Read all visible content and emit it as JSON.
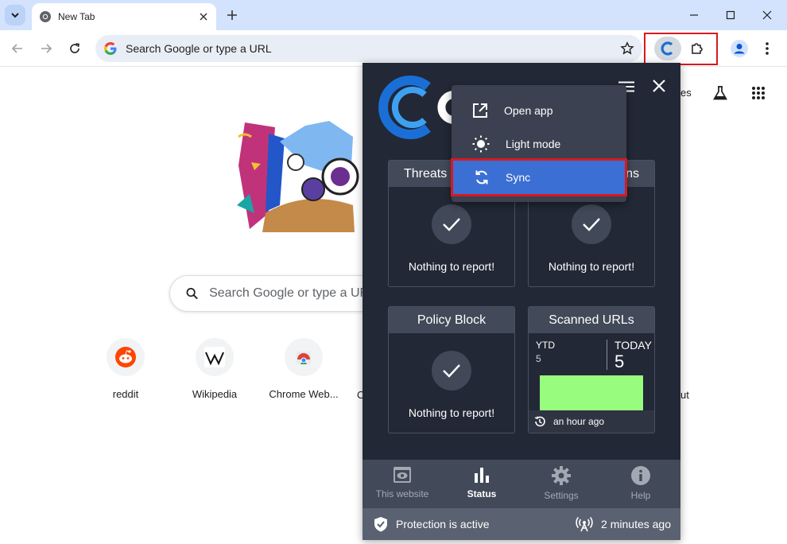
{
  "browser": {
    "tab_title": "New Tab",
    "omnibox_placeholder": "Search Google or type a URL"
  },
  "ntp": {
    "search_placeholder": "Search Google or type a URL",
    "shortcuts": [
      {
        "label": "reddit"
      },
      {
        "label": "Wikipedia"
      },
      {
        "label": "Chrome Web..."
      }
    ],
    "partial_labels": {
      "left_edge": "C",
      "right_edge": "ut",
      "top_right": "es"
    }
  },
  "popup": {
    "menu": {
      "items": [
        {
          "label": "Open app",
          "icon": "external-link-icon"
        },
        {
          "label": "Light mode",
          "icon": "sun-icon"
        },
        {
          "label": "Sync",
          "icon": "sync-icon",
          "selected": true
        }
      ]
    },
    "cards": {
      "threats": {
        "title_left": "Threats D",
        "title_right": "ns",
        "message": "Nothing to report!"
      },
      "detections": {
        "message": "Nothing to report!"
      },
      "policy": {
        "title": "Policy Block",
        "message": "Nothing to report!"
      },
      "scanned": {
        "title": "Scanned URLs",
        "ytd_label": "YTD",
        "ytd_value": "5",
        "today_label": "TODAY",
        "today_value": "5",
        "bar_fill_fraction": 1.0,
        "bar_color": "#98fc7f",
        "updated": "an hour ago"
      }
    },
    "nav": [
      {
        "label": "This website",
        "icon": "eye-icon"
      },
      {
        "label": "Status",
        "icon": "bar-chart-icon",
        "active": true
      },
      {
        "label": "Settings",
        "icon": "gear-icon"
      },
      {
        "label": "Help",
        "icon": "info-icon"
      }
    ],
    "status": {
      "protection": "Protection is active",
      "last_update": "2 minutes ago"
    },
    "colors": {
      "background": "#222836",
      "card_header": "#424958",
      "menu_selected": "#3b6fd4",
      "highlight_border": "#d7191f"
    }
  }
}
